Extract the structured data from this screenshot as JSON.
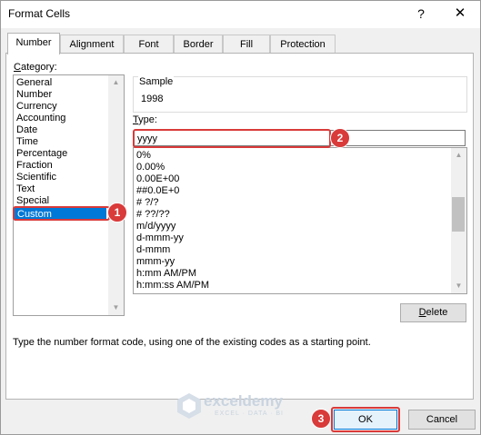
{
  "dialog": {
    "title": "Format Cells",
    "help": "?",
    "close": "✕"
  },
  "tabs": [
    "Number",
    "Alignment",
    "Font",
    "Border",
    "Fill",
    "Protection"
  ],
  "category": {
    "label_ul": "C",
    "label_rest": "ategory:",
    "items": [
      "General",
      "Number",
      "Currency",
      "Accounting",
      "Date",
      "Time",
      "Percentage",
      "Fraction",
      "Scientific",
      "Text",
      "Special",
      "Custom"
    ],
    "selected": "Custom"
  },
  "sample": {
    "label": "Sample",
    "value": "1998"
  },
  "type": {
    "label_ul": "T",
    "label_rest": "ype:",
    "value": "yyyy"
  },
  "formats": [
    "0%",
    "0.00%",
    "0.00E+00",
    "##0.0E+0",
    "# ?/?",
    "# ??/??",
    "m/d/yyyy",
    "d-mmm-yy",
    "d-mmm",
    "mmm-yy",
    "h:mm AM/PM",
    "h:mm:ss AM/PM"
  ],
  "delete_button": {
    "label_ul": "D",
    "label_rest": "elete"
  },
  "description": "Type the number format code, using one of the existing codes as a starting point.",
  "ok_label": "OK",
  "cancel_label": "Cancel",
  "callouts": [
    "1",
    "2",
    "3"
  ],
  "watermark": {
    "title": "exceldemy",
    "subtitle": "EXCEL · DATA · BI"
  },
  "colors": {
    "accent": "#0078d7",
    "callout": "#d93a3a"
  }
}
